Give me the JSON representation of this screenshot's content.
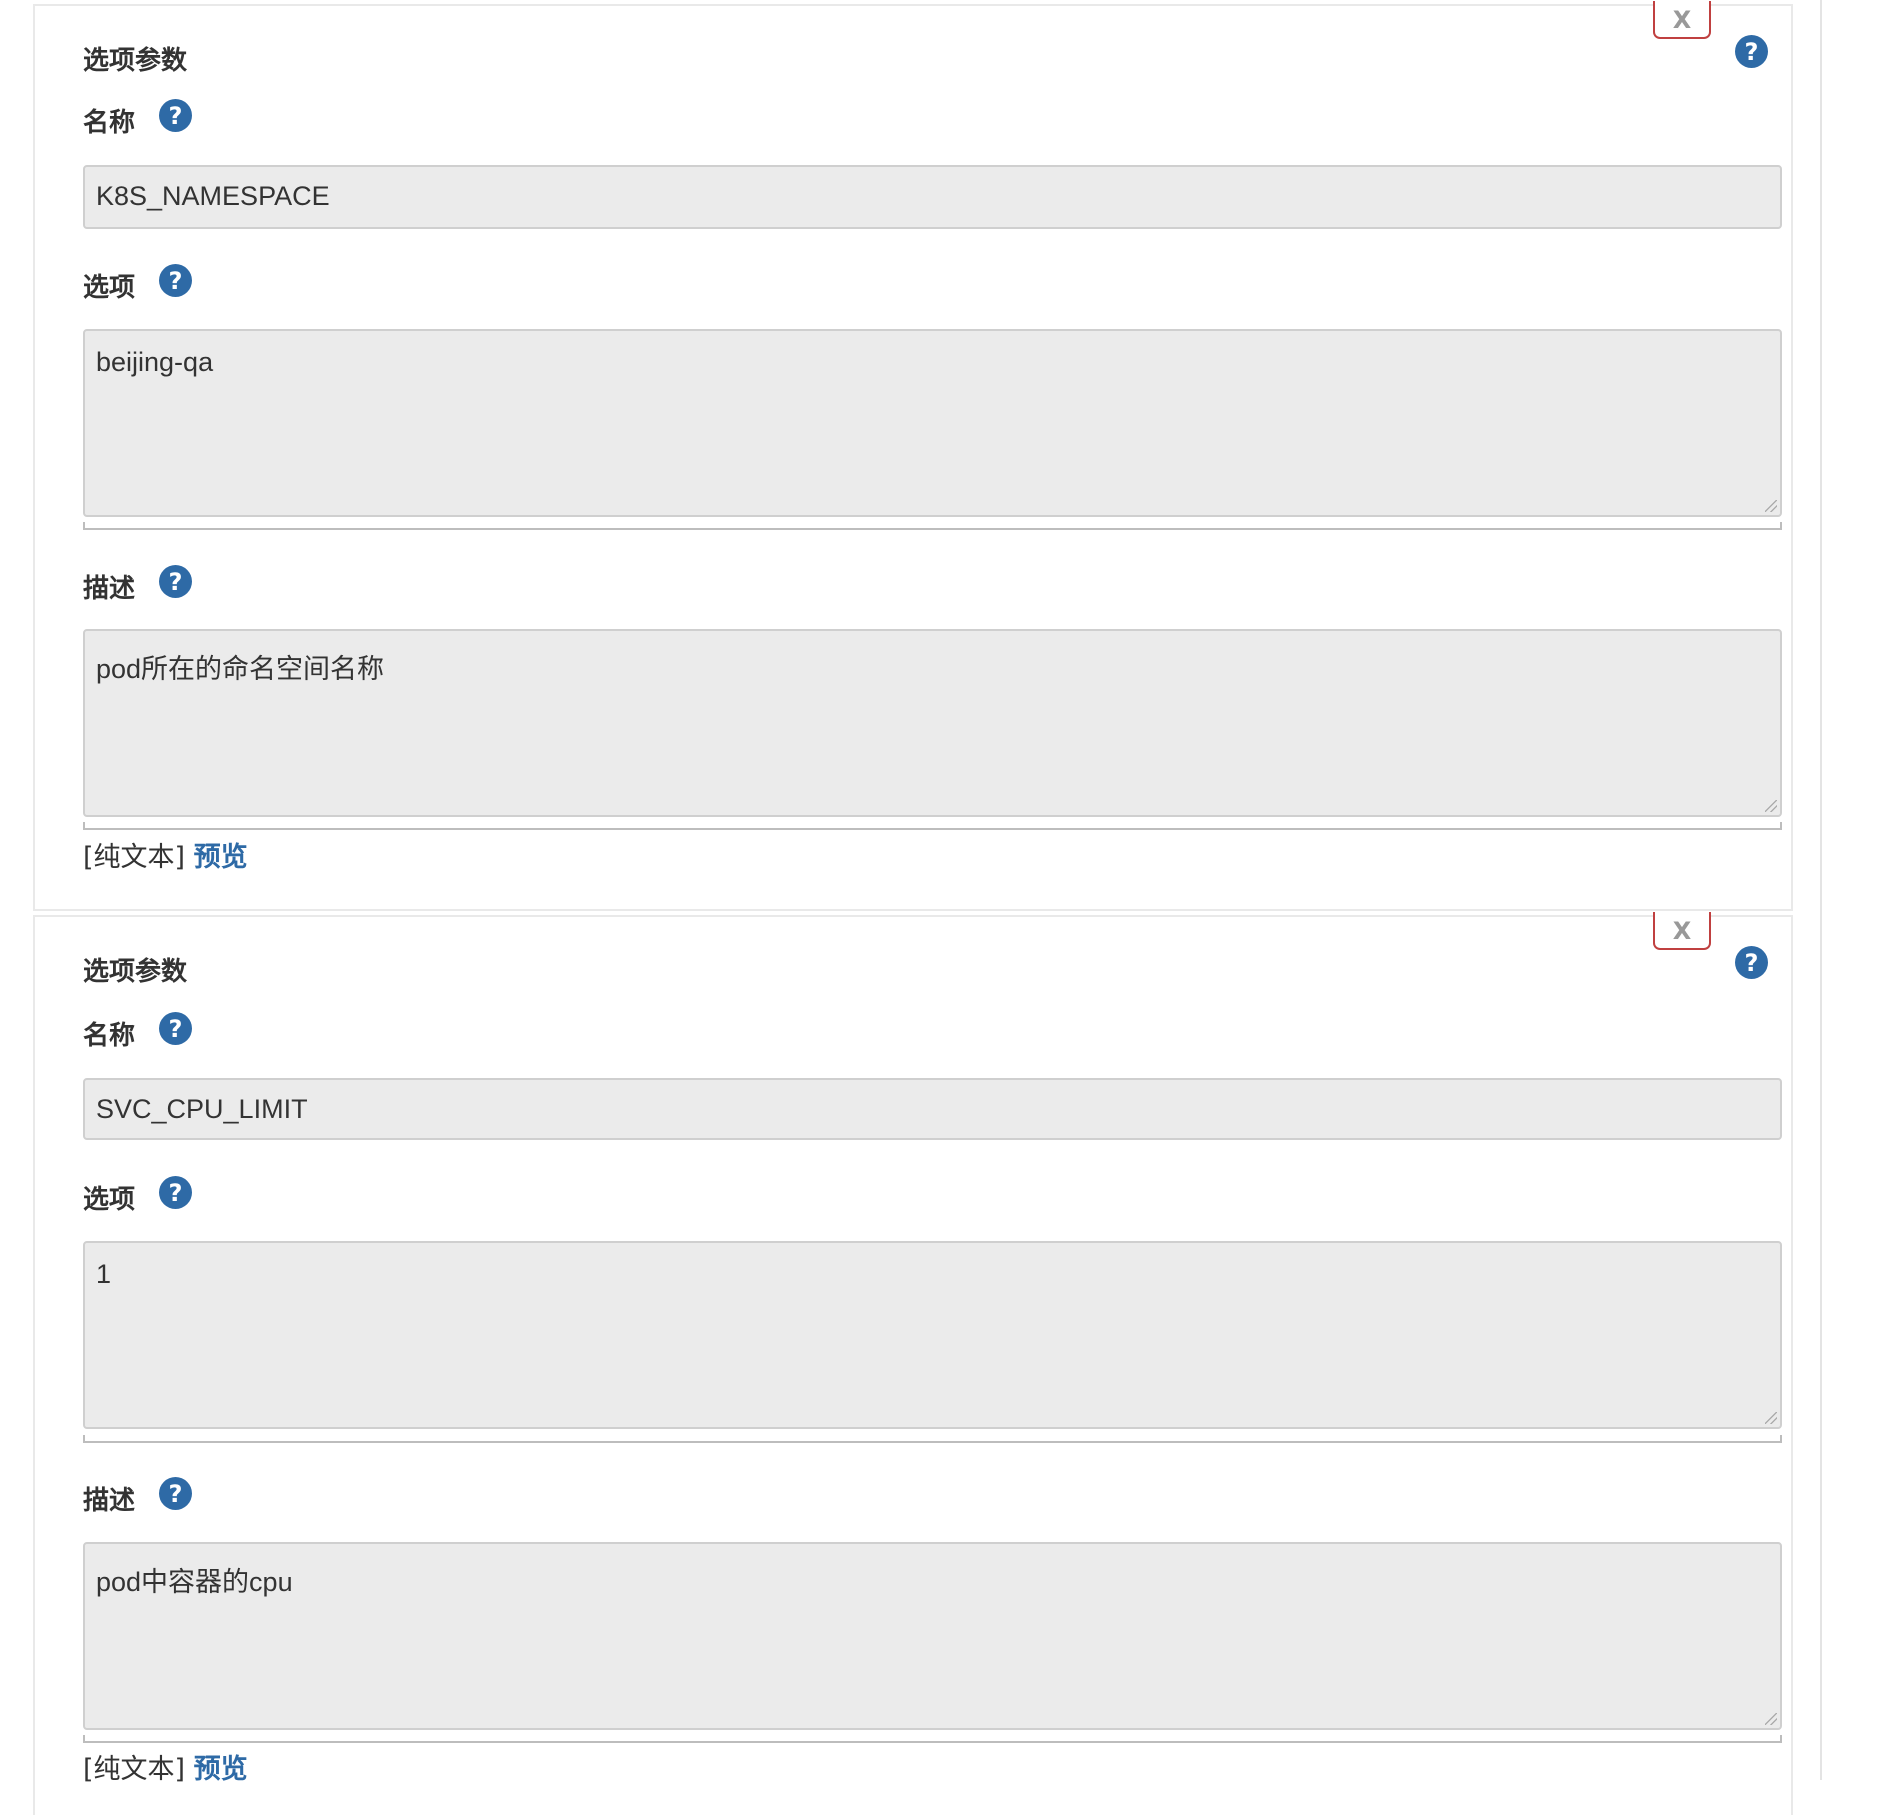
{
  "panels": [
    {
      "title": "选项参数",
      "close_label": "X",
      "help_glyph": "?",
      "name_label": "名称",
      "name_value": "K8S_NAMESPACE",
      "choices_label": "选项",
      "choices_value": "beijing-qa",
      "description_label": "描述",
      "description_value": "pod所在的命名空间名称",
      "format_text": "[纯文本]",
      "preview_link": "预览"
    },
    {
      "title": "选项参数",
      "close_label": "X",
      "help_glyph": "?",
      "name_label": "名称",
      "name_value": "SVC_CPU_LIMIT",
      "choices_label": "选项",
      "choices_value": "1",
      "description_label": "描述",
      "description_value": "pod中容器的cpu",
      "format_text": "[纯文本]",
      "preview_link": "预览"
    }
  ],
  "colors": {
    "help_icon": "#2e6aa6",
    "close_border": "#c04040",
    "field_bg": "#ebebeb",
    "link": "#2e6aa6"
  },
  "icons": {
    "close": "close-icon",
    "help": "question-circle-icon",
    "resize": "resize-grip-icon"
  }
}
